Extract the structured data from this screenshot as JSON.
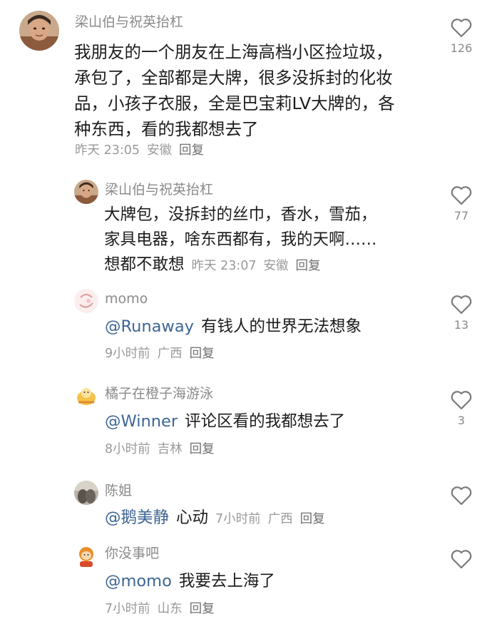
{
  "comments": [
    {
      "username": "梁山伯与祝英抬杠",
      "lines": [
        "我朋友的一个朋友在上海高档小区捡垃圾，",
        "承包了，全部都是大牌，很多没拆封的化妆",
        "品，小孩子衣服，全是巴宝莉LV大牌的，各",
        "种东西，看的我都想去了"
      ],
      "time": "昨天 23:05",
      "location": "安徽",
      "reply": "回复",
      "likes": "126"
    },
    {
      "username": "梁山伯与祝英抬杠",
      "lines": [
        "大牌包，没拆封的丝巾，香水，雪茄，",
        "家具电器，啥东西都有，我的天啊……",
        "想都不敢想"
      ],
      "time": "昨天 23:07",
      "location": "安徽",
      "reply": "回复",
      "likes": "77"
    },
    {
      "username": "momo",
      "mention": "@Runaway",
      "text": "有钱人的世界无法想象",
      "time": "9小时前",
      "location": "广西",
      "reply": "回复",
      "likes": "13"
    },
    {
      "username": "橘子在橙子海游泳",
      "mention": "@Winner",
      "text": "评论区看的我都想去了",
      "time": "8小时前",
      "location": "吉林",
      "reply": "回复",
      "likes": "3"
    },
    {
      "username": "陈姐",
      "mention": "@鹅美静",
      "text": "心动",
      "time": "7小时前",
      "location": "广西",
      "reply": "回复",
      "likes": ""
    },
    {
      "username": "你没事吧",
      "mention": "@momo",
      "text": "我要去上海了",
      "time": "7小时前",
      "location": "山东",
      "reply": "回复",
      "likes": ""
    }
  ],
  "icons": {
    "like": "heart-outline-icon"
  },
  "colors": {
    "mention": "#3d6694",
    "meta": "#9a9a9a",
    "username": "#8a8a8a"
  }
}
